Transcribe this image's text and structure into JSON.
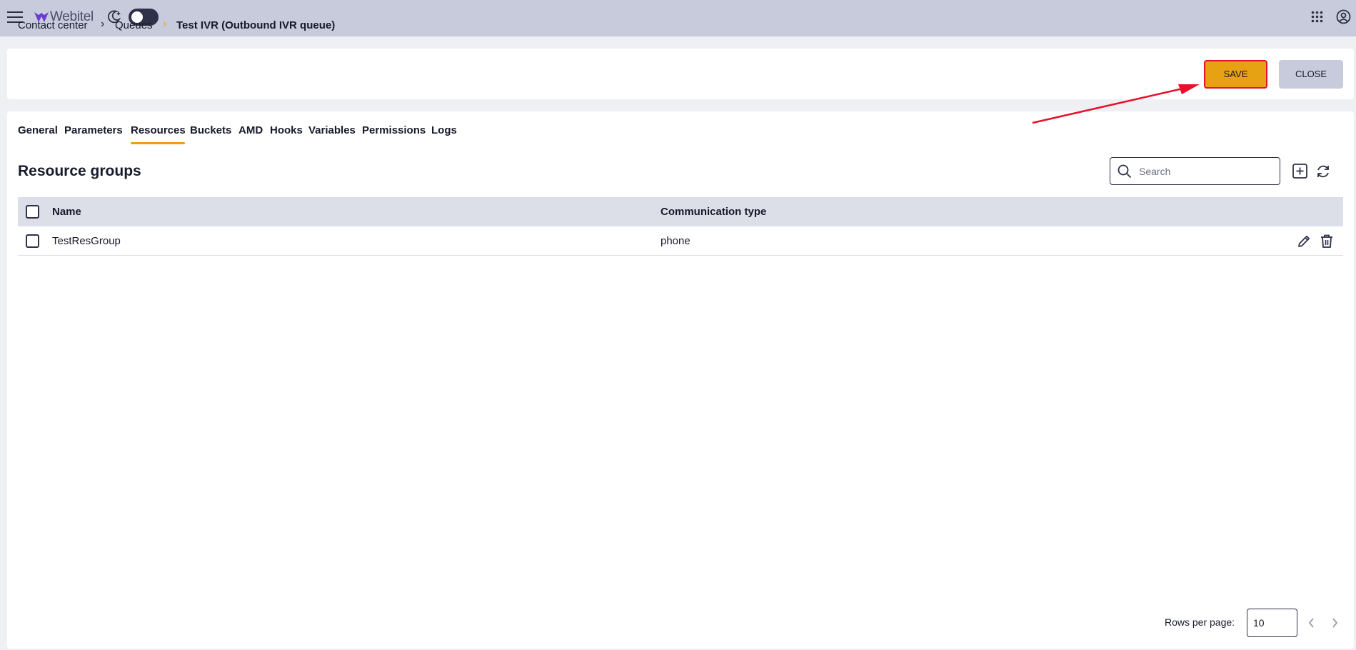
{
  "topbar": {
    "brand": "Webitel",
    "icons": [
      "hamburger-menu-icon",
      "webitel-logo-icon",
      "moon-icon",
      "apps-grid-icon",
      "account-icon"
    ]
  },
  "breadcrumb": {
    "items": [
      "Contact center",
      "Queues",
      "Test IVR (Outbound IVR queue)"
    ],
    "separator": "›"
  },
  "actions": {
    "save_label": "SAVE",
    "close_label": "CLOSE"
  },
  "tabs": [
    "General",
    "Parameters",
    "Resources",
    "Buckets",
    "AMD",
    "Hooks",
    "Variables",
    "Permissions",
    "Logs"
  ],
  "active_tab": "Resources",
  "section": {
    "title": "Resource groups",
    "search_placeholder": "Search",
    "search_value": ""
  },
  "table": {
    "columns": [
      "Name",
      "Communication type"
    ],
    "rows": [
      {
        "name": "TestResGroup",
        "communication_type": "phone"
      }
    ]
  },
  "pagination": {
    "rows_per_page_label": "Rows per page:",
    "rows_per_page": "10"
  },
  "colors": {
    "accent": "#e7a214",
    "topbar": "#c8cbdb",
    "annotation": "#e8102a"
  }
}
